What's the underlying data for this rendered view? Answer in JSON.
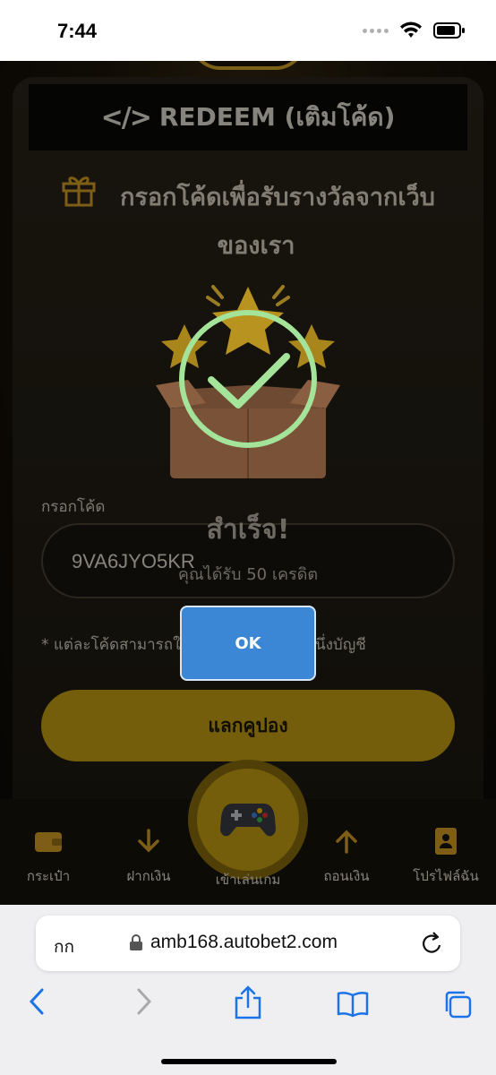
{
  "status_bar": {
    "time": "7:44"
  },
  "redeem_card": {
    "header_title": "REDEEM (เติมโค้ด)",
    "subtitle": "กรอกโค้ดเพื่อรับรางวัลจากเว็บของเรา",
    "input_label": "กรอกโค้ด",
    "code_value": "9VA6JYO5KR",
    "note_left": "* แต่ละโค้ดสามารถใช้",
    "note_right": "นึ่งบัญชี",
    "redeem_button": "แลกคูปอง"
  },
  "success_dialog": {
    "title": "สำเร็จ!",
    "message": "คุณได้รับ 50 เครดิต",
    "ok_button": "OK"
  },
  "bottom_nav": {
    "wallet": "กระเป๋า",
    "deposit": "ฝากเงิน",
    "play": "เข้าเล่นเกม",
    "withdraw": "ถอนเงิน",
    "profile": "โปรไฟล์ฉัน"
  },
  "browser": {
    "aa": "กก",
    "url": "amb168.autobet2.com"
  },
  "colors": {
    "gold": "#c9a213",
    "ok_blue": "#3b87d6",
    "success_green": "#a4e39a"
  }
}
